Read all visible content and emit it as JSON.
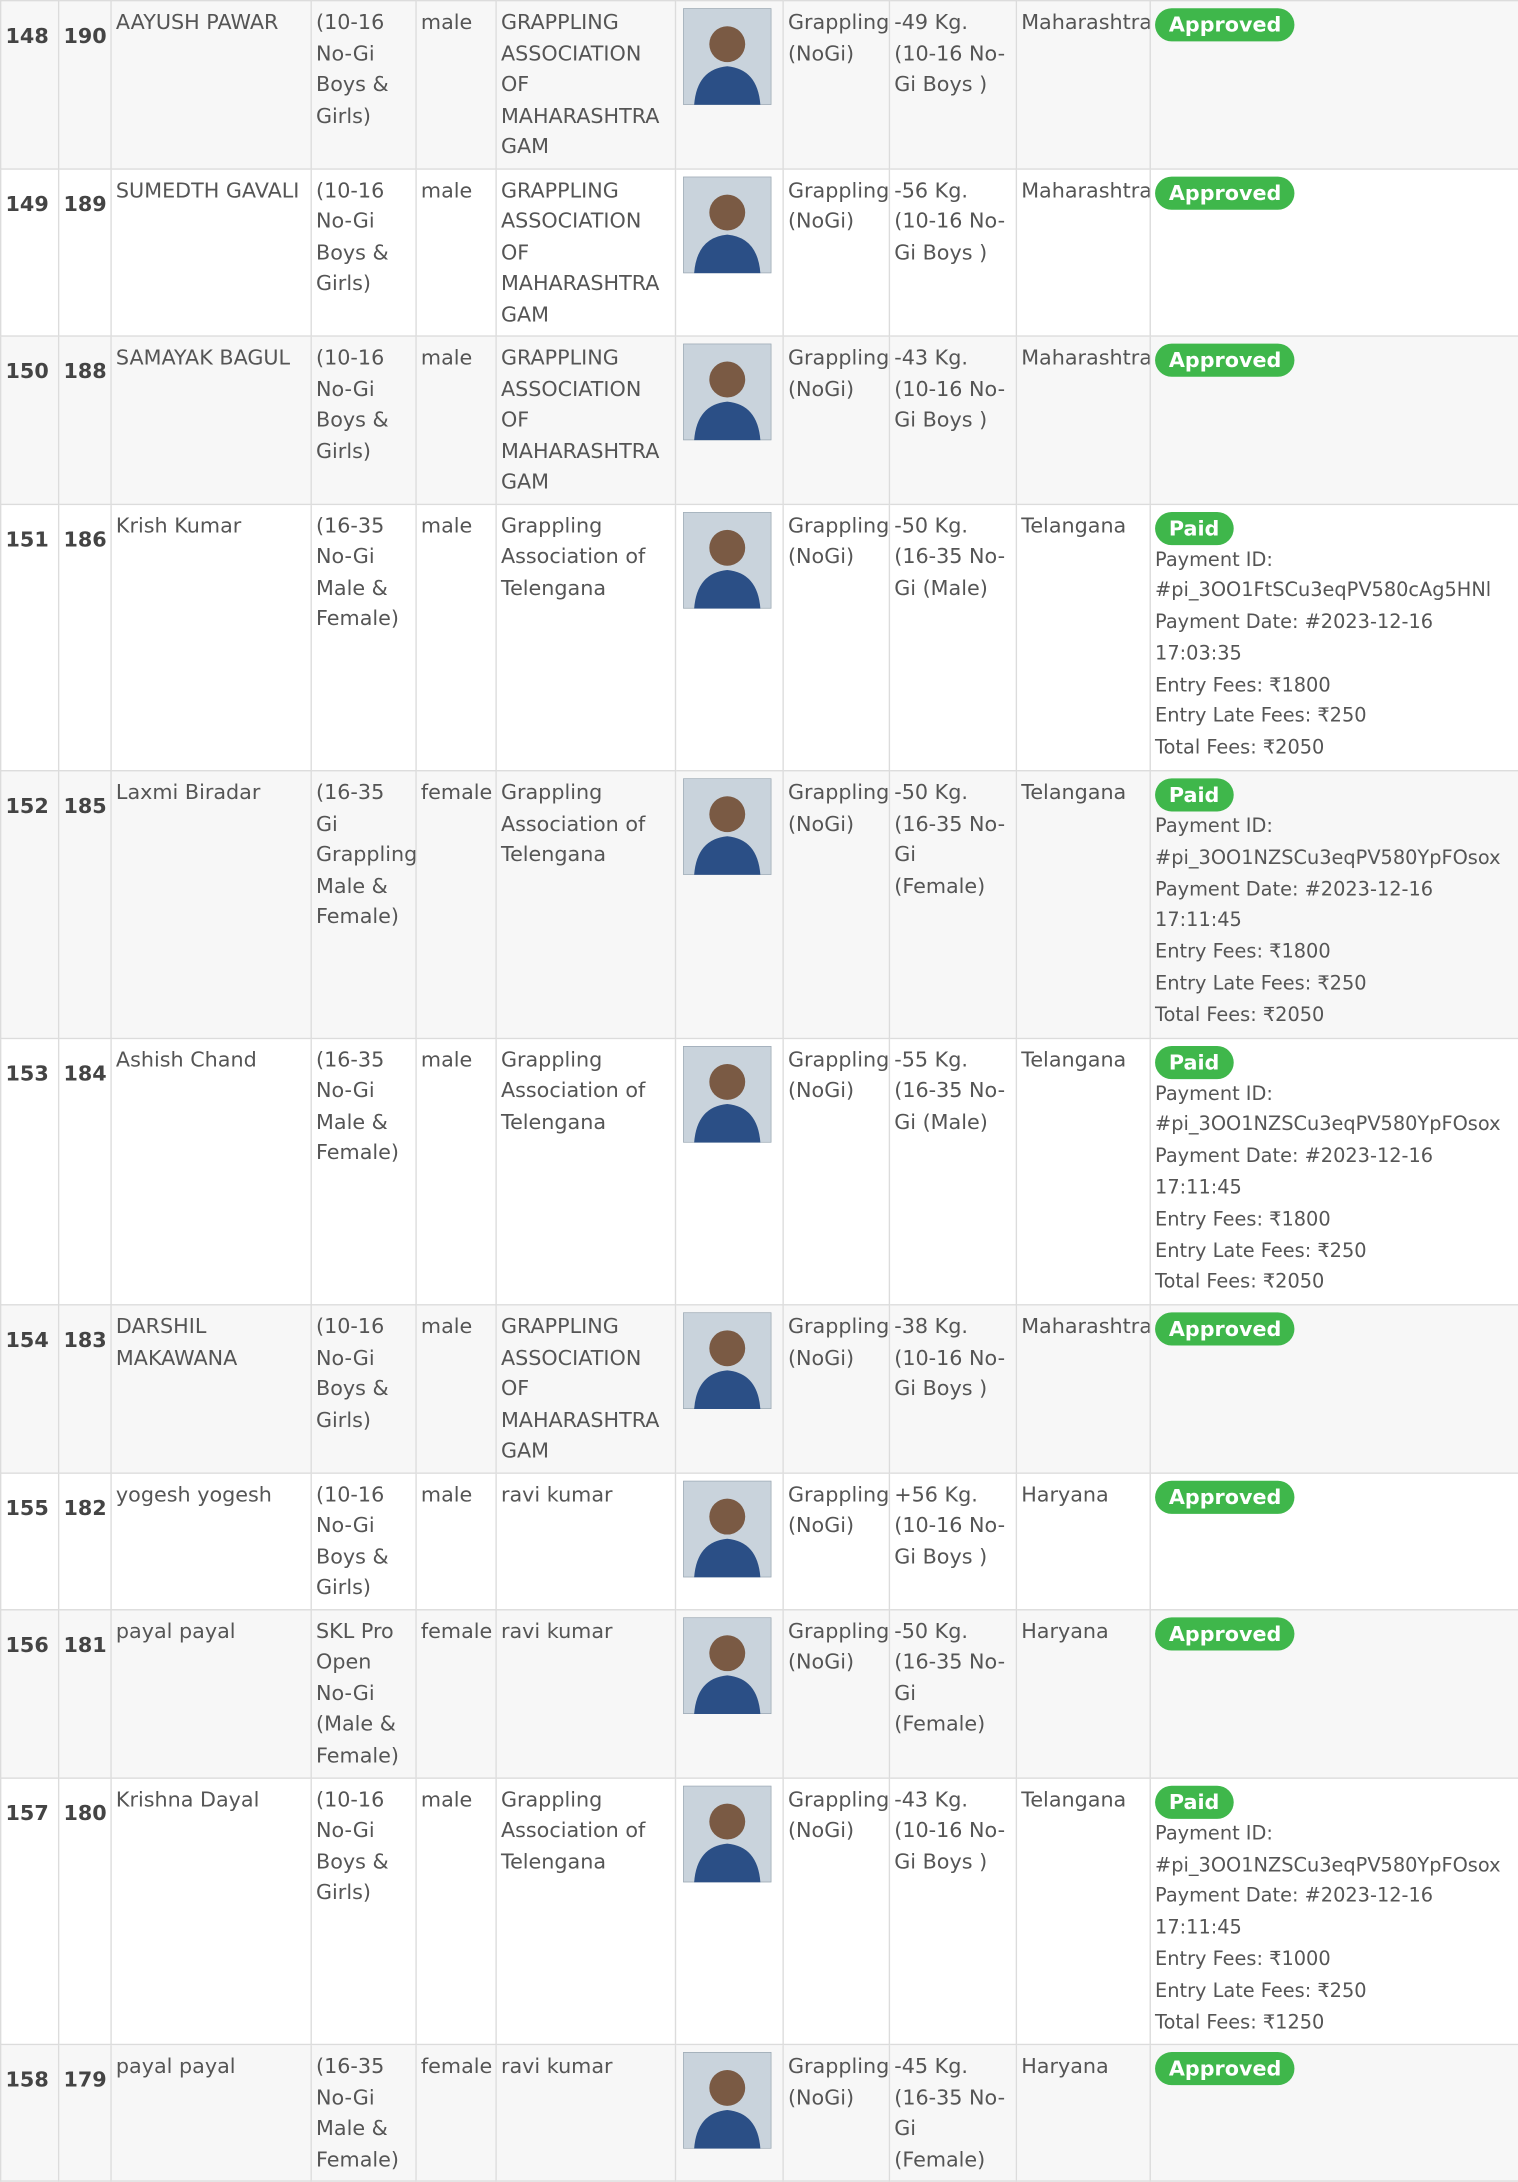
{
  "colors": {
    "approved": "#3fb74b",
    "paid": "#3fb74b"
  },
  "rows": [
    {
      "sno": "148",
      "id": "190",
      "name": "AAYUSH PAWAR",
      "category": "(10-16 No-Gi Boys & Girls)",
      "gender": "male",
      "association": "GRAPPLING ASSOCIATION OF MAHARASHTRA GAM",
      "discipline": "Grappling (NoGi)",
      "weight": "-49 Kg. (10-16 No-Gi Boys )",
      "state": "Maharashtra",
      "status": "Approved",
      "payment": []
    },
    {
      "sno": "149",
      "id": "189",
      "name": "SUMEDTH GAVALI",
      "category": "(10-16 No-Gi Boys & Girls)",
      "gender": "male",
      "association": "GRAPPLING ASSOCIATION OF MAHARASHTRA GAM",
      "discipline": "Grappling (NoGi)",
      "weight": "-56 Kg. (10-16 No-Gi Boys )",
      "state": "Maharashtra",
      "status": "Approved",
      "payment": []
    },
    {
      "sno": "150",
      "id": "188",
      "name": "SAMAYAK BAGUL",
      "category": "(10-16 No-Gi Boys & Girls)",
      "gender": "male",
      "association": "GRAPPLING ASSOCIATION OF MAHARASHTRA GAM",
      "discipline": "Grappling (NoGi)",
      "weight": "-43 Kg. (10-16 No-Gi Boys )",
      "state": "Maharashtra",
      "status": "Approved",
      "payment": []
    },
    {
      "sno": "151",
      "id": "186",
      "name": "Krish Kumar",
      "category": "(16-35 No-Gi Male & Female)",
      "gender": "male",
      "association": "Grappling Association of Telengana",
      "discipline": "Grappling (NoGi)",
      "weight": "-50 Kg. (16-35 No-Gi (Male)",
      "state": "Telangana",
      "status": "Paid",
      "payment": [
        "Payment ID:",
        "#pi_3OO1FtSCu3eqPV580cAg5HNl",
        "Payment Date: #2023-12-16",
        "17:03:35",
        "Entry Fees: ₹1800",
        "Entry Late Fees: ₹250",
        "Total Fees: ₹2050"
      ]
    },
    {
      "sno": "152",
      "id": "185",
      "name": "Laxmi Biradar",
      "category": "(16-35 Gi Grappling Male & Female)",
      "gender": "female",
      "association": "Grappling Association of Telengana",
      "discipline": "Grappling (NoGi)",
      "weight": "-50 Kg. (16-35 No-Gi (Female)",
      "state": "Telangana",
      "status": "Paid",
      "payment": [
        "Payment ID:",
        "#pi_3OO1NZSCu3eqPV580YpFOsox",
        "Payment Date: #2023-12-16",
        "17:11:45",
        "Entry Fees: ₹1800",
        "Entry Late Fees: ₹250",
        "Total Fees: ₹2050"
      ]
    },
    {
      "sno": "153",
      "id": "184",
      "name": "Ashish Chand",
      "category": "(16-35 No-Gi Male & Female)",
      "gender": "male",
      "association": "Grappling Association of Telengana",
      "discipline": "Grappling (NoGi)",
      "weight": "-55 Kg. (16-35 No-Gi (Male)",
      "state": "Telangana",
      "status": "Paid",
      "payment": [
        "Payment ID:",
        "#pi_3OO1NZSCu3eqPV580YpFOsox",
        "Payment Date: #2023-12-16",
        "17:11:45",
        "Entry Fees: ₹1800",
        "Entry Late Fees: ₹250",
        "Total Fees: ₹2050"
      ]
    },
    {
      "sno": "154",
      "id": "183",
      "name": "DARSHIL MAKAWANA",
      "category": "(10-16 No-Gi Boys & Girls)",
      "gender": "male",
      "association": "GRAPPLING ASSOCIATION OF MAHARASHTRA GAM",
      "discipline": "Grappling (NoGi)",
      "weight": "-38 Kg. (10-16 No-Gi Boys )",
      "state": "Maharashtra",
      "status": "Approved",
      "payment": []
    },
    {
      "sno": "155",
      "id": "182",
      "name": "yogesh yogesh",
      "category": "(10-16 No-Gi Boys & Girls)",
      "gender": "male",
      "association": "ravi kumar",
      "discipline": "Grappling (NoGi)",
      "weight": "+56 Kg. (10-16 No-Gi Boys )",
      "state": "Haryana",
      "status": "Approved",
      "payment": []
    },
    {
      "sno": "156",
      "id": "181",
      "name": "payal payal",
      "category": "SKL Pro Open No-Gi (Male & Female)",
      "gender": "female",
      "association": "ravi kumar",
      "discipline": "Grappling (NoGi)",
      "weight": "-50 Kg. (16-35 No-Gi (Female)",
      "state": "Haryana",
      "status": "Approved",
      "payment": []
    },
    {
      "sno": "157",
      "id": "180",
      "name": "Krishna Dayal",
      "category": "(10-16 No-Gi Boys & Girls)",
      "gender": "male",
      "association": "Grappling Association of Telengana",
      "discipline": "Grappling (NoGi)",
      "weight": "-43 Kg. (10-16 No-Gi Boys )",
      "state": "Telangana",
      "status": "Paid",
      "payment": [
        "Payment ID:",
        "#pi_3OO1NZSCu3eqPV580YpFOsox",
        "Payment Date: #2023-12-16",
        "17:11:45",
        "Entry Fees: ₹1000",
        "Entry Late Fees: ₹250",
        "Total Fees: ₹1250"
      ]
    },
    {
      "sno": "158",
      "id": "179",
      "name": "payal payal",
      "category": "(16-35 No-Gi Male & Female)",
      "gender": "female",
      "association": "ravi kumar",
      "discipline": "Grappling (NoGi)",
      "weight": "-45 Kg. (16-35 No-Gi (Female)",
      "state": "Haryana",
      "status": "Approved",
      "payment": []
    }
  ]
}
